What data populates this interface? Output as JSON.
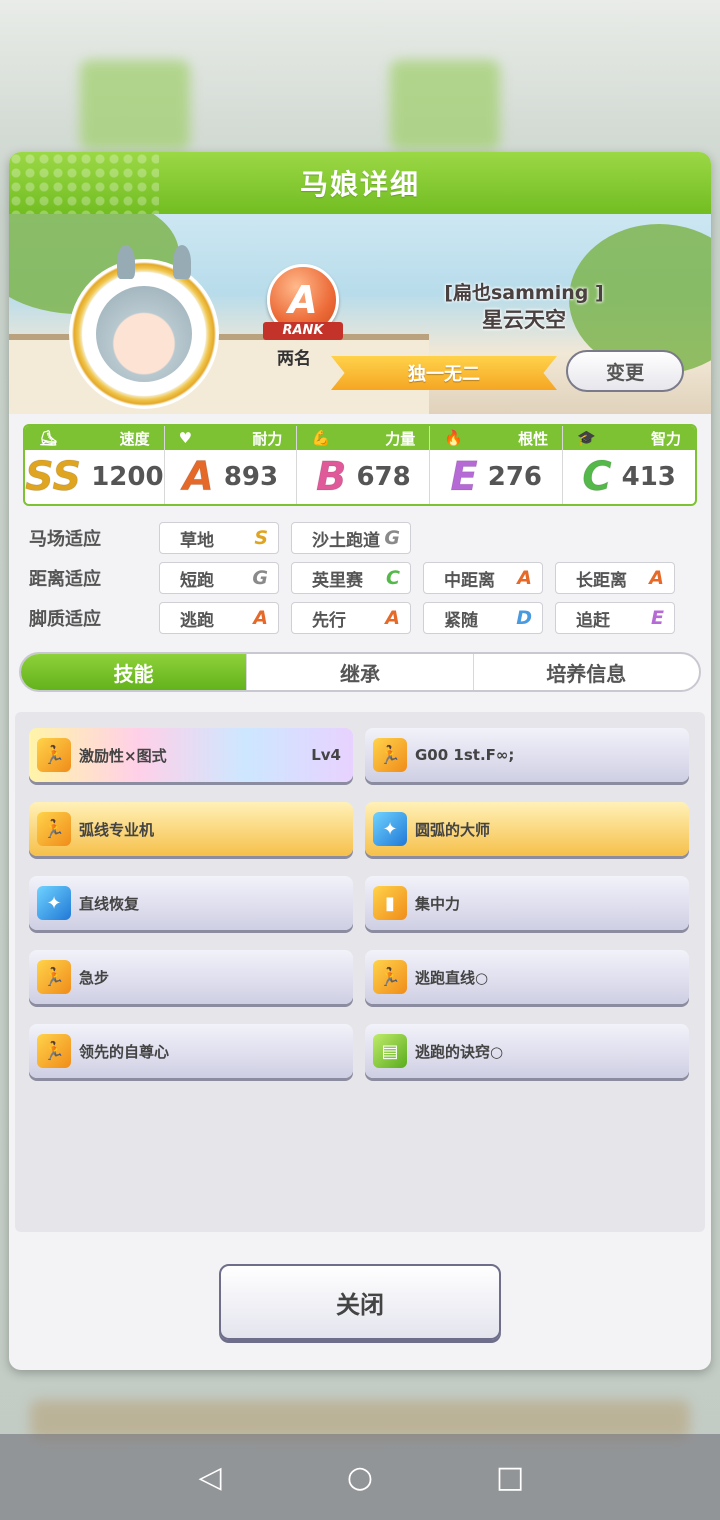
{
  "modal": {
    "title": "马娘详细",
    "rank": {
      "grade": "A",
      "ribbon": "RANK",
      "label": "两名"
    },
    "trainer": "[扁也samming ]",
    "horse_name": "星云天空",
    "epithet": "独一无二",
    "change_label": "变更"
  },
  "stats": [
    {
      "label": "速度",
      "grade": "SS",
      "value": "1200",
      "color": "#e0a520"
    },
    {
      "label": "耐力",
      "grade": "A",
      "value": "893",
      "color": "#e56a2a"
    },
    {
      "label": "力量",
      "grade": "B",
      "value": "678",
      "color": "#e05a9a"
    },
    {
      "label": "根性",
      "grade": "E",
      "value": "276",
      "color": "#b56ad6"
    },
    {
      "label": "智力",
      "grade": "C",
      "value": "413",
      "color": "#55b84a"
    }
  ],
  "aptitude": {
    "track_label": "马场适应",
    "track": [
      {
        "name": "草地",
        "grade": "S"
      },
      {
        "name": "沙土跑道",
        "grade": "G"
      }
    ],
    "distance_label": "距离适应",
    "distance": [
      {
        "name": "短跑",
        "grade": "G"
      },
      {
        "name": "英里赛",
        "grade": "C"
      },
      {
        "name": "中距离",
        "grade": "A"
      },
      {
        "name": "长距离",
        "grade": "A"
      }
    ],
    "style_label": "脚质适应",
    "style": [
      {
        "name": "逃跑",
        "grade": "A"
      },
      {
        "name": "先行",
        "grade": "A"
      },
      {
        "name": "紧随",
        "grade": "D"
      },
      {
        "name": "追赶",
        "grade": "E"
      }
    ]
  },
  "tabs": [
    "技能",
    "继承",
    "培养信息"
  ],
  "skills": [
    {
      "name": "激励性×图式",
      "level": "Lv4",
      "style": "rainbow",
      "icon": "run-icon"
    },
    {
      "name": "G00 1st.F∞;",
      "level": "",
      "style": "normal",
      "icon": "run-icon"
    },
    {
      "name": "弧线专业机",
      "level": "",
      "style": "gold",
      "icon": "run-icon"
    },
    {
      "name": "圆弧的大师",
      "level": "",
      "style": "gold",
      "icon": "sparkle-icon"
    },
    {
      "name": "直线恢复",
      "level": "",
      "style": "normal",
      "icon": "sparkle-icon"
    },
    {
      "name": "集中力",
      "level": "",
      "style": "normal",
      "icon": "gate-icon"
    },
    {
      "name": "急步",
      "level": "",
      "style": "normal",
      "icon": "run-icon"
    },
    {
      "name": "逃跑直线○",
      "level": "",
      "style": "normal",
      "icon": "run-icon"
    },
    {
      "name": "领先的自尊心",
      "level": "",
      "style": "normal",
      "icon": "run-icon"
    },
    {
      "name": "逃跑的诀窍○",
      "level": "",
      "style": "normal",
      "icon": "book-icon"
    }
  ],
  "close_label": "关闭",
  "navbar": {
    "back": "◁",
    "home": "○",
    "recent": "□"
  }
}
